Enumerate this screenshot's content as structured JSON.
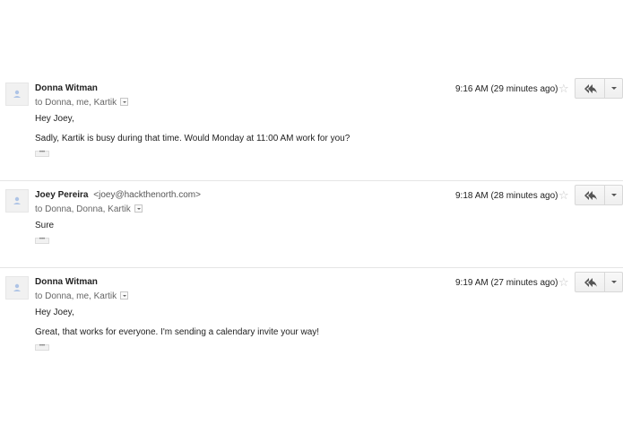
{
  "messages": [
    {
      "sender_name": "Donna Witman",
      "sender_email": "",
      "recipients": "to Donna, me, Kartik",
      "timestamp": "9:16 AM (29 minutes ago)",
      "body": [
        "Hey Joey,",
        "Sadly, Kartik is busy during that time. Would Monday at 11:00 AM work for you?"
      ],
      "more_dots": "•••"
    },
    {
      "sender_name": "Joey Pereira",
      "sender_email": "<joey@hackthenorth.com>",
      "recipients": "to Donna, Donna, Kartik",
      "timestamp": "9:18 AM (28 minutes ago)",
      "body": [
        "Sure"
      ],
      "more_dots": "•••"
    },
    {
      "sender_name": "Donna Witman",
      "sender_email": "",
      "recipients": "to Donna, me, Kartik",
      "timestamp": "9:19 AM (27 minutes ago)",
      "body": [
        "Hey Joey,",
        "Great, that works for everyone. I'm sending a calendary invite your way!"
      ],
      "more_dots": "•••"
    }
  ],
  "icons": {
    "star": "☆",
    "avatar": "person-silhouette-icon",
    "reply_all": "reply-all-icon",
    "more": "chevron-down-icon"
  },
  "colors": {
    "avatar_fg": "#aec4e6",
    "divider": "#e5e5e5",
    "star": "#c4c4c4"
  }
}
